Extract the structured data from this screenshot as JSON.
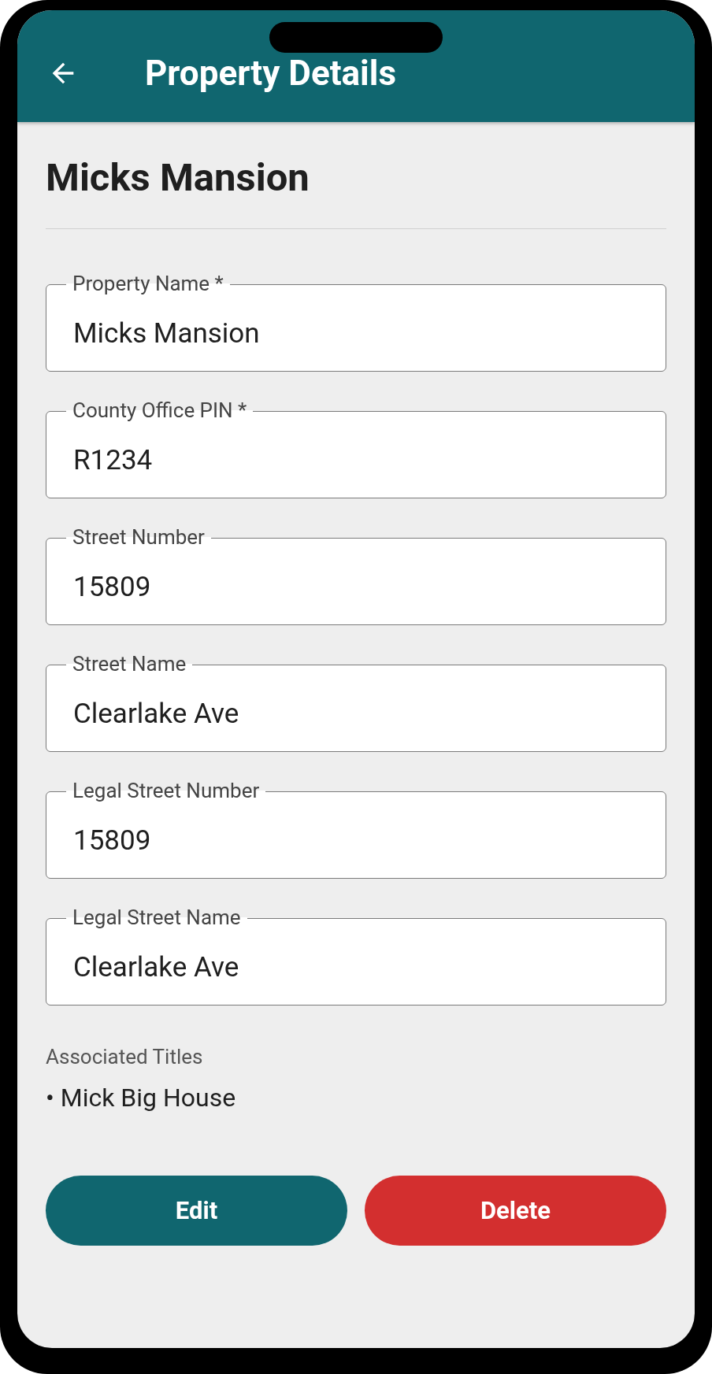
{
  "app_bar": {
    "title": "Property Details"
  },
  "heading": "Micks Mansion",
  "fields": [
    {
      "label": "Property Name *",
      "value": "Micks Mansion"
    },
    {
      "label": "County Office PIN *",
      "value": "R1234"
    },
    {
      "label": "Street Number",
      "value": "15809"
    },
    {
      "label": "Street Name",
      "value": "Clearlake Ave"
    },
    {
      "label": "Legal Street Number",
      "value": "15809"
    },
    {
      "label": "Legal Street Name",
      "value": "Clearlake Ave"
    }
  ],
  "associated_titles": {
    "label": "Associated Titles",
    "items": [
      "• Mick Big House"
    ]
  },
  "buttons": [
    {
      "label": "Edit",
      "kind": "primary"
    },
    {
      "label": "Delete",
      "kind": "danger"
    }
  ]
}
